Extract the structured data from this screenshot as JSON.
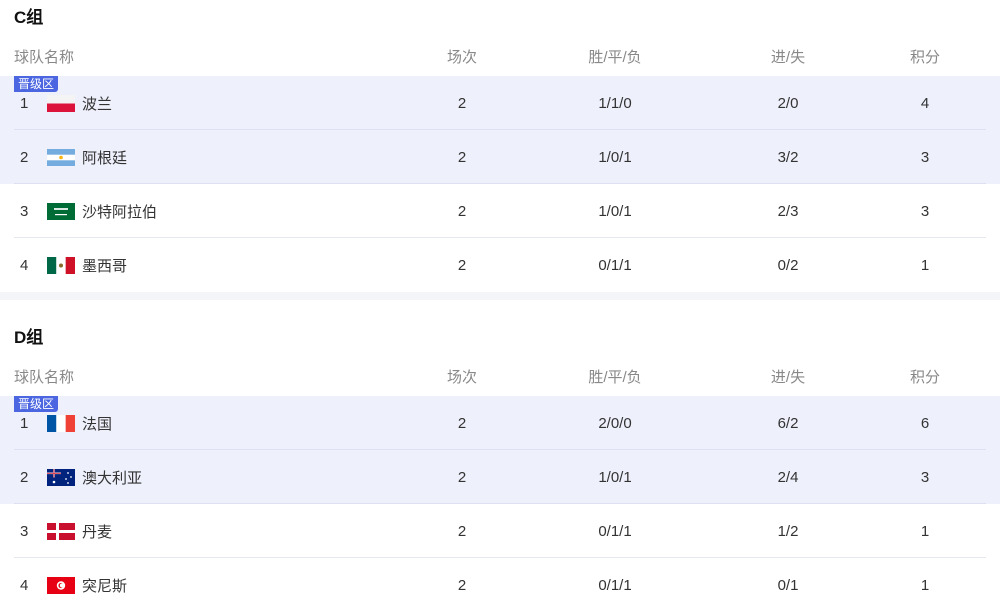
{
  "headers": {
    "team": "球队名称",
    "played": "场次",
    "wdl": "胜/平/负",
    "goals": "进/失",
    "points": "积分"
  },
  "qualify_badge": "晋级区",
  "groups": [
    {
      "title": "C组",
      "rows": [
        {
          "rank": "1",
          "team": "波兰",
          "flag": "poland-flag",
          "played": "2",
          "wdl": "1/1/0",
          "goals": "2/0",
          "points": "4",
          "qualify": true
        },
        {
          "rank": "2",
          "team": "阿根廷",
          "flag": "argentina-flag",
          "played": "2",
          "wdl": "1/0/1",
          "goals": "3/2",
          "points": "3",
          "qualify": true
        },
        {
          "rank": "3",
          "team": "沙特阿拉伯",
          "flag": "saudi-arabia-flag",
          "played": "2",
          "wdl": "1/0/1",
          "goals": "2/3",
          "points": "3",
          "qualify": false
        },
        {
          "rank": "4",
          "team": "墨西哥",
          "flag": "mexico-flag",
          "played": "2",
          "wdl": "0/1/1",
          "goals": "0/2",
          "points": "1",
          "qualify": false
        }
      ]
    },
    {
      "title": "D组",
      "rows": [
        {
          "rank": "1",
          "team": "法国",
          "flag": "france-flag",
          "played": "2",
          "wdl": "2/0/0",
          "goals": "6/2",
          "points": "6",
          "qualify": true
        },
        {
          "rank": "2",
          "team": "澳大利亚",
          "flag": "australia-flag",
          "played": "2",
          "wdl": "1/0/1",
          "goals": "2/4",
          "points": "3",
          "qualify": true
        },
        {
          "rank": "3",
          "team": "丹麦",
          "flag": "denmark-flag",
          "played": "2",
          "wdl": "0/1/1",
          "goals": "1/2",
          "points": "1",
          "qualify": false
        },
        {
          "rank": "4",
          "team": "突尼斯",
          "flag": "tunisia-flag",
          "played": "2",
          "wdl": "0/1/1",
          "goals": "0/1",
          "points": "1",
          "qualify": false
        }
      ]
    }
  ],
  "colors": {
    "qualify_bg": "#eef0fc",
    "badge_bg": "#4b66e0"
  }
}
